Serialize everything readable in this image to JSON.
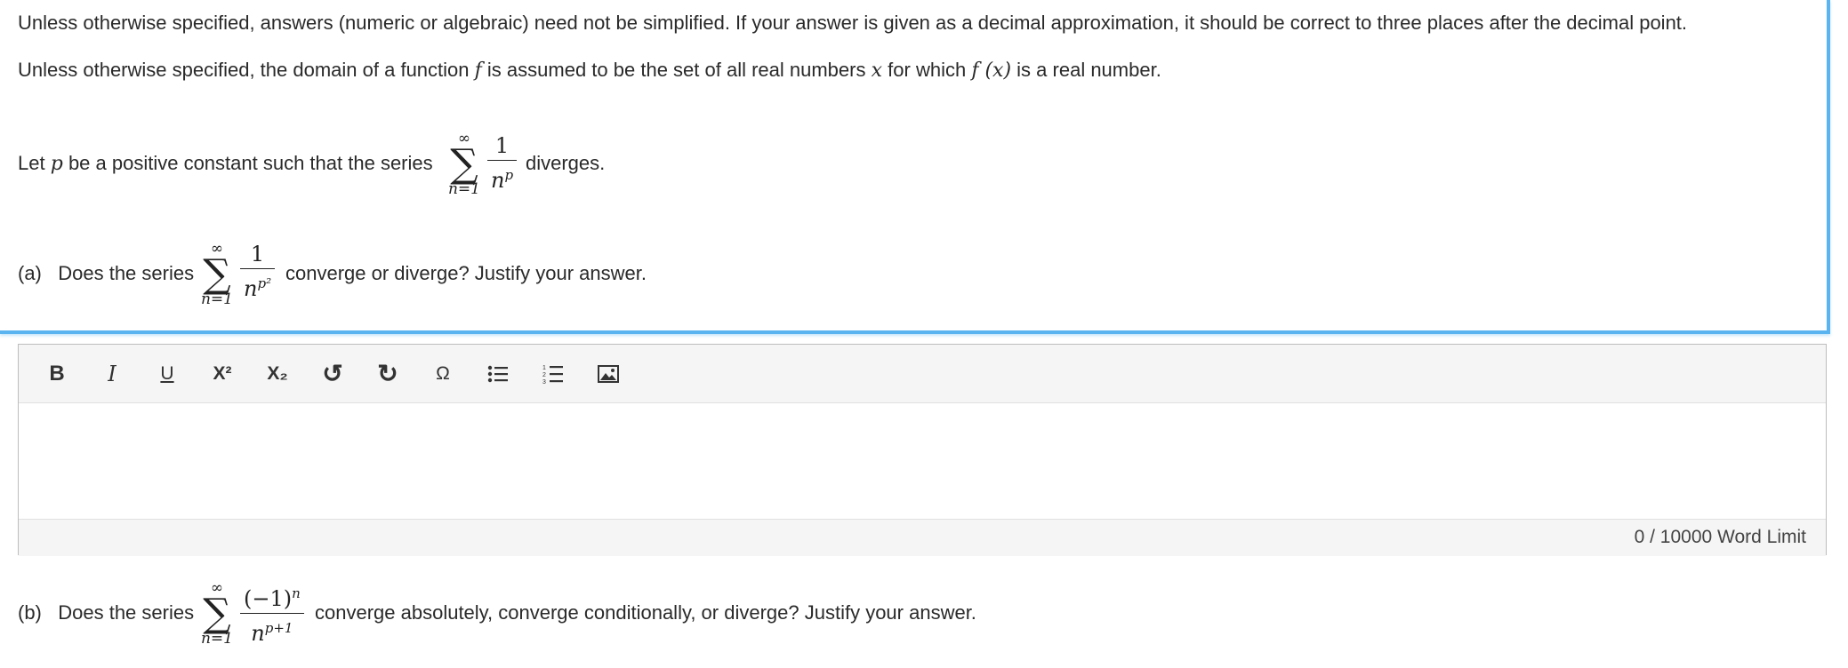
{
  "instructions": {
    "line1": "Unless otherwise specified, answers (numeric or algebraic) need not be simplified. If your answer is given as a decimal approximation, it should be correct to three places after the decimal point.",
    "line2_a": "Unless otherwise specified, the domain of a function",
    "line2_f": "f",
    "line2_b": "is assumed to be the set of all real numbers",
    "line2_x": "x",
    "line2_c": "for which",
    "line2_fx": "f (x)",
    "line2_d": "is a real number."
  },
  "intro": {
    "let": "Let",
    "p": "p",
    "text": "be a positive constant such that the series",
    "sum_upper": "∞",
    "sum_lower": "n=1",
    "numerator": "1",
    "den_base": "n",
    "den_exp": "p",
    "end": "diverges."
  },
  "part_a": {
    "label": "(a)",
    "text": "Does the series",
    "sum_upper": "∞",
    "sum_lower": "n=1",
    "numerator": "1",
    "den_base": "n",
    "den_exp": "p²",
    "end": "converge or diverge? Justify your answer."
  },
  "editor": {
    "toolbar": {
      "bold": "B",
      "italic": "I",
      "underline": "U",
      "superscript": "X²",
      "subscript": "X₂",
      "undo": "↺",
      "redo": "↻",
      "special_char": "Ω"
    },
    "word_count": "0 / 10000 Word Limit"
  },
  "part_b": {
    "label": "(b)",
    "text": "Does the series",
    "sum_upper": "∞",
    "sum_lower": "n=1",
    "numerator": "(−1)",
    "num_exp": "n",
    "den_base": "n",
    "den_exp": "p+1",
    "end": "converge absolutely, converge conditionally, or diverge? Justify your answer."
  }
}
